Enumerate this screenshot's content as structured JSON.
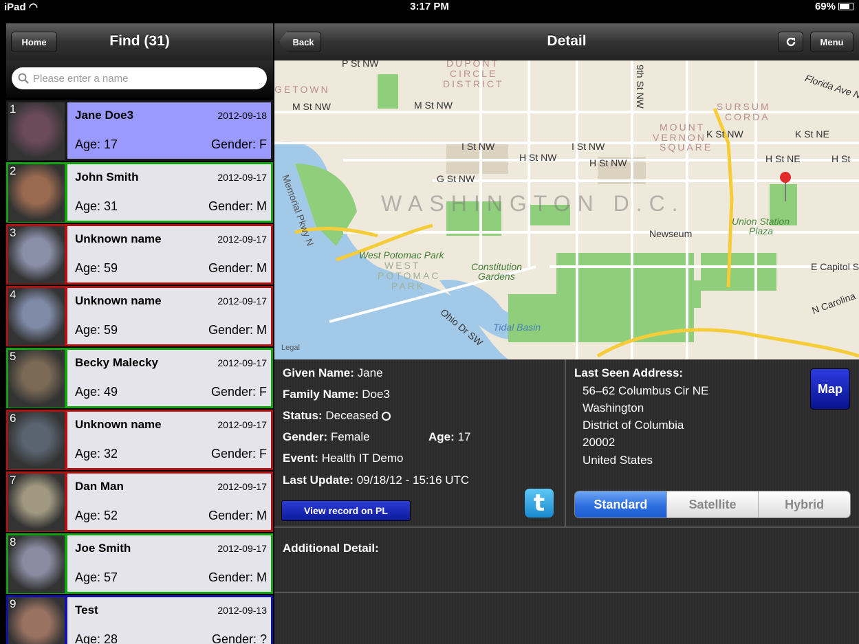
{
  "status_bar": {
    "device": "iPad",
    "time": "3:17 PM",
    "battery": "69%",
    "battery_level": 0.69
  },
  "left_nav": {
    "home_label": "Home",
    "title": "Find (31)"
  },
  "search": {
    "placeholder": "Please enter a name"
  },
  "results": [
    {
      "num": "1",
      "name": "Jane Doe3",
      "date": "2012-09-18",
      "age": "Age: 17",
      "gender": "Gender: F",
      "status_color": "#1a1a1a",
      "bg": "#9999ff",
      "photo_tone": "#6b4a5a"
    },
    {
      "num": "2",
      "name": "John Smith",
      "date": "2012-09-17",
      "age": "Age: 31",
      "gender": "Gender: M",
      "status_color": "#13a313",
      "bg": "#e4e4ea",
      "photo_tone": "#9a6a50"
    },
    {
      "num": "3",
      "name": "Unknown name",
      "date": "2012-09-17",
      "age": "Age: 59",
      "gender": "Gender: M",
      "status_color": "#b01313",
      "bg": "#e4e4ea",
      "photo_tone": "#8a8fa8"
    },
    {
      "num": "4",
      "name": "Unknown name",
      "date": "2012-09-17",
      "age": "Age: 59",
      "gender": "Gender: M",
      "status_color": "#b01313",
      "bg": "#e4e4ea",
      "photo_tone": "#7f8aa6"
    },
    {
      "num": "5",
      "name": "Becky Malecky",
      "date": "2012-09-17",
      "age": "Age: 49",
      "gender": "Gender: F",
      "status_color": "#13a313",
      "bg": "#e4e4ea",
      "photo_tone": "#7a6a55"
    },
    {
      "num": "6",
      "name": "Unknown name",
      "date": "2012-09-17",
      "age": "Age: 32",
      "gender": "Gender: F",
      "status_color": "#b01313",
      "bg": "#e4e4ea",
      "photo_tone": "#5a6470"
    },
    {
      "num": "7",
      "name": "Dan Man",
      "date": "2012-09-17",
      "age": "Age: 52",
      "gender": "Gender: M",
      "status_color": "#b01313",
      "bg": "#e4e4ea",
      "photo_tone": "#a09880"
    },
    {
      "num": "8",
      "name": "Joe Smith",
      "date": "2012-09-17",
      "age": "Age: 57",
      "gender": "Gender: M",
      "status_color": "#13a313",
      "bg": "#e4e4ea",
      "photo_tone": "#8a8aa0"
    },
    {
      "num": "9",
      "name": "Test",
      "date": "2012-09-13",
      "age": "Age: 28",
      "gender": "Gender: ?",
      "status_color": "#1111aa",
      "bg": "#e4e4ea",
      "photo_tone": "#9a7262"
    }
  ],
  "detail_nav": {
    "back_label": "Back",
    "title": "Detail",
    "refresh_icon": "refresh-icon",
    "menu_label": "Menu"
  },
  "map": {
    "legal_label": "Legal",
    "labels": {
      "p_st": "P St NW",
      "dupont": "DUPONT",
      "circle": "CIRCLE",
      "district": "DISTRICT",
      "georgetown": "GETOWN",
      "m_st": "M St NW",
      "m_st2": "M St NW",
      "ninth_st": "9th St NW",
      "sursum": "SURSUM",
      "corda": "CORDA",
      "mount": "MOUNT",
      "vernon": "VERNON",
      "square": "SQUARE",
      "florida": "Florida Ave N",
      "k_st": "K St NW",
      "k_ne": "K St NE",
      "i_st": "I St NW",
      "i_st2": "I St NW",
      "h_st": "H St NW",
      "h_st2": "H St NW",
      "h_ne": "H St NE",
      "h_st3": "H St",
      "g_st": "G St NW",
      "washington": "WASHINGTON D.C.",
      "memorial": "Memorial Pkwy N",
      "newseum": "Newseum",
      "union": "Union Station",
      "plaza": "Plaza",
      "west_potomac": "West Potomac Park",
      "west": "WEST",
      "potomac": "POTOMAC",
      "park": "PARK",
      "constitution": "Constitution",
      "gardens": "Gardens",
      "ohio": "Ohio Dr SW",
      "tidal": "Tidal Basin",
      "e_capitol": "E Capitol S",
      "n_carolina": "N Carolina"
    }
  },
  "person": {
    "given_name_label": "Given Name:",
    "given_name": "Jane",
    "family_name_label": "Family Name:",
    "family_name": "Doe3",
    "status_label": "Status:",
    "status": "Deceased",
    "gender_label": "Gender:",
    "gender": "Female",
    "age_label": "Age:",
    "age": "17",
    "event_label": "Event:",
    "event": "Health IT Demo",
    "last_update_label": "Last Update:",
    "last_update": "09/18/12 - 15:16 UTC",
    "view_record_label": "View record on PL",
    "twitter_icon": "twitter-icon"
  },
  "address": {
    "label": "Last Seen Address:",
    "street": "56–62 Columbus Cir NE",
    "city": "Washington",
    "region": "District of Columbia",
    "zip": "20002",
    "country": "United States",
    "map_button": "Map",
    "map_types": [
      "Standard",
      "Satellite",
      "Hybrid"
    ],
    "selected_map_type": "Standard"
  },
  "additional": {
    "label": "Additional Detail:"
  }
}
